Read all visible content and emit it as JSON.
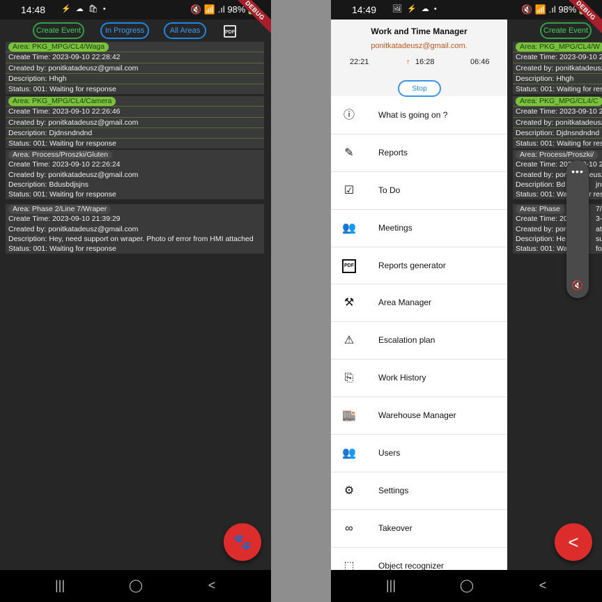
{
  "left": {
    "status": {
      "time": "14:48",
      "icons": "⚡ ☁ 🛍 •",
      "right": "🔇 📶 .ıl 98%🔋"
    },
    "debug_label": "DEBUG",
    "actions": {
      "create_event": "Create Event",
      "in_progress": "In Progress",
      "all_areas": "All Areas",
      "pdf": "PDF"
    },
    "events": [
      {
        "area": "Area: PKG_MPG/CL4/Waga",
        "create_time": "Create Time: 2023-09-10 22:28:42",
        "created_by": "Created by: ponitkatadeusz@gmail.com",
        "description": "Description: Hhgh",
        "status": "Status: 001: Waiting for response"
      },
      {
        "area": "Area: PKG_MPG/CL4/Camera",
        "create_time": "Create Time: 2023-09-10 22:26:46",
        "created_by": "Created by: ponitkatadeusz@gmail.com",
        "description": "Description:  Djdnsndndnd",
        "status": "Status: 001: Waiting for response"
      },
      {
        "area": "Area: Process/Proszki/Gluten",
        "create_time": "Create Time: 2023-09-10 22:26:24",
        "created_by": "Created by: ponitkatadeusz@gmail.com",
        "description": "Description: Bdusbdjsjns",
        "status": "Status: 001: Waiting for response"
      },
      {
        "area": "Area: Phase 2/Line 7/Wraper",
        "create_time": "Create Time: 2023-09-10 21:39:29",
        "created_by": "Created by: ponitkatadeusz@gmail.com",
        "description": "Description: Hey, need support on wraper. Photo of error from HMI attached",
        "status": "Status: 001: Waiting for response"
      }
    ],
    "fab_icon": "🐾",
    "nav": {
      "recents": "|||",
      "home": "◯",
      "back": "<"
    }
  },
  "right": {
    "status": {
      "time": "14:49",
      "icons": "🖼 ⚡ ☁ •",
      "right": "🔇 📶 .ıl 98%🔋"
    },
    "debug_label": "DEBUG",
    "drawer": {
      "title": "Work and Time Manager",
      "email": "ponitkatadeusz@gmail.com.",
      "time_start": "22:21",
      "time_mid": "16:28",
      "time_mid_arrow": "↑",
      "time_end": "06:46",
      "stop": "Stop",
      "items": [
        {
          "label": "What is going on ?",
          "icon": "ⓘ"
        },
        {
          "label": "Reports",
          "icon": "✎"
        },
        {
          "label": "To Do",
          "icon": "☑"
        },
        {
          "label": "Meetings",
          "icon": "👥"
        },
        {
          "label": "Reports generator",
          "icon": "PDF"
        },
        {
          "label": "Area Manager",
          "icon": "⚒"
        },
        {
          "label": "Escalation plan",
          "icon": "⚠"
        },
        {
          "label": "Work History",
          "icon": "⎘"
        },
        {
          "label": "Warehouse Manager",
          "icon": "🏬"
        },
        {
          "label": "Users",
          "icon": "👥"
        },
        {
          "label": "Settings",
          "icon": "⚙"
        },
        {
          "label": "Takeover",
          "icon": "∞"
        },
        {
          "label": "Object recognizer",
          "icon": "⬚"
        }
      ]
    },
    "bg_actions": {
      "create_event": "Create Event"
    },
    "bg_events": [
      {
        "area": "Area: PKG_MPG/CL4/W",
        "create_time": "Create Time: 2023-09-10 2",
        "created_by": "Created by: ponitkatadeusz",
        "description": "Description: Hhgh",
        "status": "Status: 001: Waiting for res"
      },
      {
        "area": "Area: PKG_MPG/CL4/C",
        "create_time": "Create Time: 2023-09-10 2",
        "created_by": "Created by: ponitkatadeusz",
        "description": "Description:  Djdnsndndnd",
        "status": "Status: 001: Waiting for res"
      },
      {
        "area": "Area: Process/Proszki/",
        "create_time": "Create Time: 2023-09-10 2",
        "created_by": "Created by: ponitkatadeusz",
        "description": "Description: Bd",
        "description_tail": "jns",
        "status": "Status: 001: Waiting for res"
      },
      {
        "area": "Area: Phase ",
        "area_tail": "7/W",
        "create_time": "Create Time: 20",
        "create_time_tail": "3-09-10 2",
        "created_by": "Created by: por",
        "created_by_tail": "atadeusz",
        "description": "Description: He",
        "description_tail": "supp",
        "status": "Status: 001: Wa",
        "status_tail": "for res"
      }
    ],
    "volume": {
      "dots": "•••",
      "icon": "🔇"
    },
    "fab_icon": "<",
    "nav": {
      "recents": "|||",
      "home": "◯",
      "back": "<"
    }
  }
}
